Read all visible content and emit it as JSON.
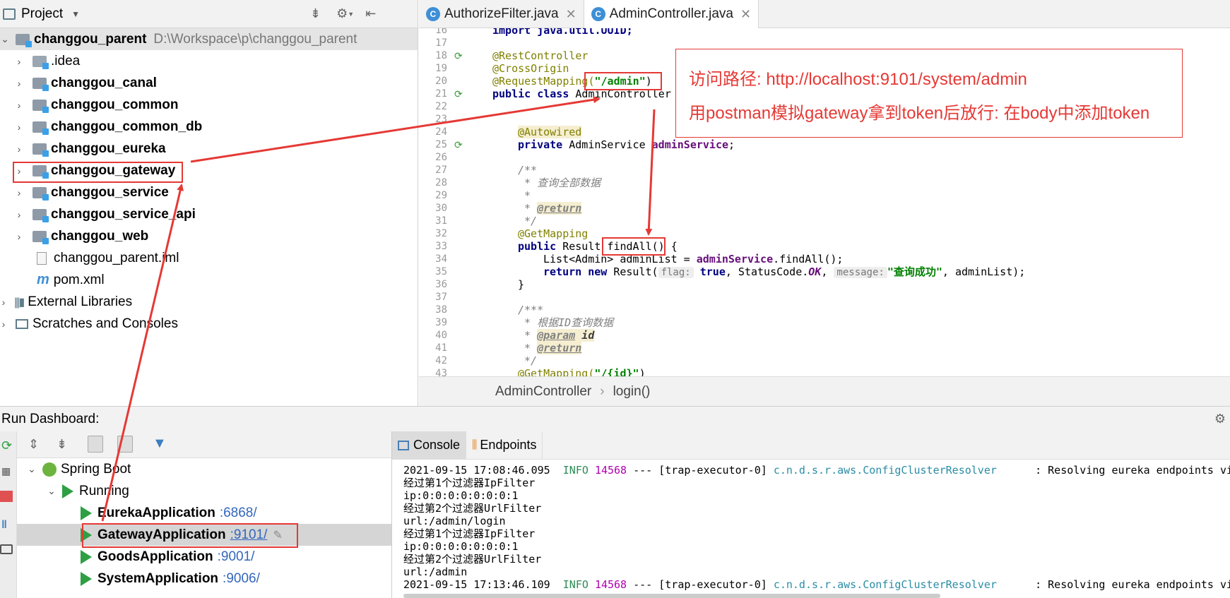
{
  "project": {
    "title": "Project",
    "root": {
      "name": "changgou_parent",
      "path": "D:\\Workspace\\p\\changgou_parent"
    },
    "items": [
      {
        "label": ".idea",
        "bold": false
      },
      {
        "label": "changgou_canal",
        "bold": true
      },
      {
        "label": "changgou_common",
        "bold": true
      },
      {
        "label": "changgou_common_db",
        "bold": true
      },
      {
        "label": "changgou_eureka",
        "bold": true
      },
      {
        "label": "changgou_gateway",
        "bold": true
      },
      {
        "label": "changgou_service",
        "bold": true
      },
      {
        "label": "changgou_service_api",
        "bold": true
      },
      {
        "label": "changgou_web",
        "bold": true
      },
      {
        "label": "changgou_parent.iml",
        "bold": false
      },
      {
        "label": "pom.xml",
        "bold": false
      }
    ],
    "external": "External Libraries",
    "scratches": "Scratches and Consoles"
  },
  "tabs": [
    {
      "label": "AuthorizeFilter.java"
    },
    {
      "label": "AdminController.java"
    }
  ],
  "code": {
    "l16": "import java.util.UUID;",
    "l18": "@RestController",
    "l19": "@CrossOrigin",
    "l20a": "@RequestMapping(",
    "l20b": "\"/admin\"",
    "l20c": ")",
    "l21a": "public class ",
    "l21b": "AdminController {",
    "l24": "@Autowired",
    "l25a": "private ",
    "l25b": "AdminService ",
    "l25c": "adminService",
    "l25d": ";",
    "l27": "/**",
    "l28": " * 查询全部数据",
    "l29": " *",
    "l30a": " * ",
    "l30b": "@return",
    "l31": " */",
    "l32": "@GetMapping",
    "l33a": "public ",
    "l33b": "Result findAll() {",
    "l34a": "List<Admin> adminList = ",
    "l34b": "adminService",
    "l34c": ".findAll();",
    "l35a": "return new ",
    "l35b": "Result(",
    "l35flag": "flag:",
    "l35c": "true",
    "l35d": ", StatusCode.",
    "l35e": "OK",
    "l35f": ",",
    "l35msg": "message:",
    "l35g": "\"查询成功\"",
    "l35h": ", adminList);",
    "l36": "}",
    "l38": "/***",
    "l39": " * 根据ID查询数据",
    "l40a": " * ",
    "l40b": "@param",
    "l40c": " id",
    "l41a": " * ",
    "l41b": "@return",
    "l42": " */",
    "l43a": "@GetMapping(",
    "l43b": "\"/{id}\"",
    "l43c": ")",
    "lines": [
      "16",
      "17",
      "18",
      "19",
      "20",
      "21",
      "22",
      "23",
      "24",
      "25",
      "26",
      "27",
      "28",
      "29",
      "30",
      "31",
      "32",
      "33",
      "34",
      "35",
      "36",
      "37",
      "38",
      "39",
      "40",
      "41",
      "42",
      "43"
    ]
  },
  "breadcrumb": {
    "cls": "AdminController",
    "sep": "›",
    "method": "login()"
  },
  "run": {
    "title": "Run Dashboard:",
    "spring": "Spring Boot",
    "running": "Running",
    "apps": [
      {
        "name": "EurekaApplication",
        "port": ":6868/"
      },
      {
        "name": "GatewayApplication",
        "port": ":9101/"
      },
      {
        "name": "GoodsApplication",
        "port": ":9001/"
      },
      {
        "name": "SystemApplication",
        "port": ":9006/"
      }
    ]
  },
  "console": {
    "tab_console": "Console",
    "tab_endpoints": "Endpoints",
    "log1": {
      "time": "2021-09-15 17:08:46.095",
      "level": "INFO",
      "pid": "14568",
      "mid": "--- [trap-executor-0]",
      "cls": "c.n.d.s.r.aws.ConfigClusterResolver",
      "msg": ": Resolving eureka endpoints vi"
    },
    "lines": [
      "经过第1个过滤器IpFilter",
      "ip:0:0:0:0:0:0:0:1",
      "经过第2个过滤器UrlFilter",
      "url:/admin/login",
      "经过第1个过滤器IpFilter",
      "ip:0:0:0:0:0:0:0:1",
      "经过第2个过滤器UrlFilter",
      "url:/admin"
    ],
    "log2": {
      "time": "2021-09-15 17:13:46.109",
      "level": "INFO",
      "pid": "14568",
      "mid": "--- [trap-executor-0]",
      "cls": "c.n.d.s.r.aws.ConfigClusterResolver",
      "msg": ": Resolving eureka endpoints vi"
    }
  },
  "note": {
    "line1": "访问路径: http://localhost:9101/system/admin",
    "line2": "用postman模拟gateway拿到token后放行: 在body中添加token"
  },
  "colors": {
    "annotation_red": "#e53935",
    "run_green": "#2ea043",
    "selection": "#d5d5d5"
  }
}
